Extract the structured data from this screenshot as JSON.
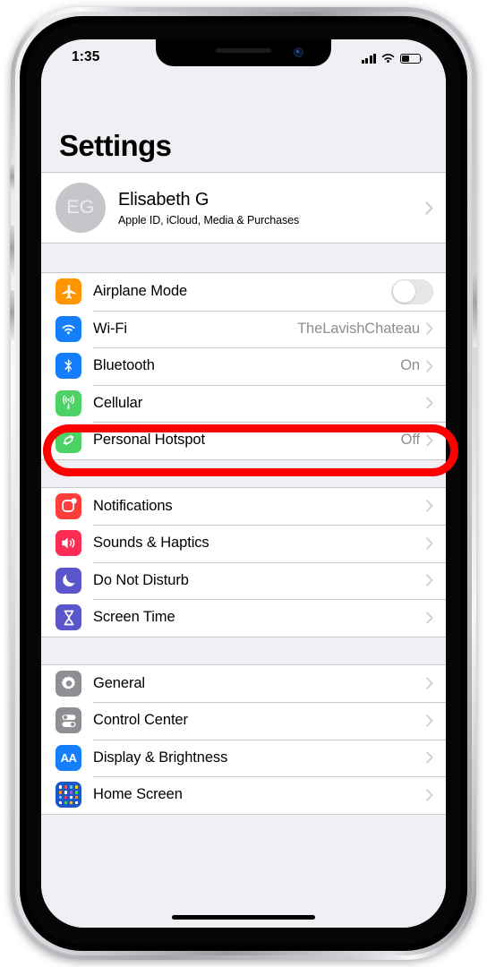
{
  "status_bar": {
    "time": "1:35",
    "signal_icon": "cellular-bars-icon",
    "wifi_icon": "wifi-icon",
    "battery_icon": "battery-icon",
    "battery_level_percent": 35
  },
  "header": {
    "title": "Settings"
  },
  "account": {
    "initials": "EG",
    "name": "Elisabeth G",
    "subtitle": "Apple ID, iCloud, Media & Purchases",
    "chevron_icon": "chevron-right-icon"
  },
  "groups": [
    {
      "id": "connectivity",
      "rows": [
        {
          "id": "airplane-mode",
          "label": "Airplane Mode",
          "icon": "airplane-icon",
          "icon_color": "#ff9500",
          "accessory": "toggle",
          "toggle_on": false,
          "value": ""
        },
        {
          "id": "wifi",
          "label": "Wi-Fi",
          "icon": "wifi-icon",
          "icon_color": "#147efb",
          "accessory": "chevron",
          "value": "TheLavishChateau"
        },
        {
          "id": "bluetooth",
          "label": "Bluetooth",
          "icon": "bluetooth-icon",
          "icon_color": "#147efb",
          "accessory": "chevron",
          "value": "On"
        },
        {
          "id": "cellular",
          "label": "Cellular",
          "icon": "cellular-antenna-icon",
          "icon_color": "#4cd265",
          "accessory": "chevron",
          "value": ""
        },
        {
          "id": "personal-hotspot",
          "label": "Personal Hotspot",
          "icon": "hotspot-link-icon",
          "icon_color": "#4cd265",
          "accessory": "chevron",
          "value": "Off"
        }
      ]
    },
    {
      "id": "alerts",
      "rows": [
        {
          "id": "notifications",
          "label": "Notifications",
          "icon": "notifications-badge-icon",
          "icon_color": "#fc3d39",
          "accessory": "chevron",
          "value": ""
        },
        {
          "id": "sounds-haptics",
          "label": "Sounds & Haptics",
          "icon": "speaker-icon",
          "icon_color": "#fc2d55",
          "accessory": "chevron",
          "value": ""
        },
        {
          "id": "do-not-disturb",
          "label": "Do Not Disturb",
          "icon": "moon-icon",
          "icon_color": "#5a55ca",
          "accessory": "chevron",
          "value": ""
        },
        {
          "id": "screen-time",
          "label": "Screen Time",
          "icon": "hourglass-icon",
          "icon_color": "#5a55ca",
          "accessory": "chevron",
          "value": ""
        }
      ]
    },
    {
      "id": "system",
      "rows": [
        {
          "id": "general",
          "label": "General",
          "icon": "gear-icon",
          "icon_color": "#8e8e93",
          "accessory": "chevron",
          "value": ""
        },
        {
          "id": "control-center",
          "label": "Control Center",
          "icon": "toggles-icon",
          "icon_color": "#8e8e93",
          "accessory": "chevron",
          "value": ""
        },
        {
          "id": "display-brightness",
          "label": "Display & Brightness",
          "icon": "aa-text-icon",
          "icon_color": "#147efb",
          "accessory": "chevron",
          "value": ""
        },
        {
          "id": "home-screen",
          "label": "Home Screen",
          "icon": "app-grid-icon",
          "icon_color": "#1b57c8",
          "accessory": "chevron",
          "value": ""
        }
      ]
    }
  ],
  "annotation": {
    "type": "oval-highlight",
    "target": "cellular",
    "color": "#ff0000"
  }
}
